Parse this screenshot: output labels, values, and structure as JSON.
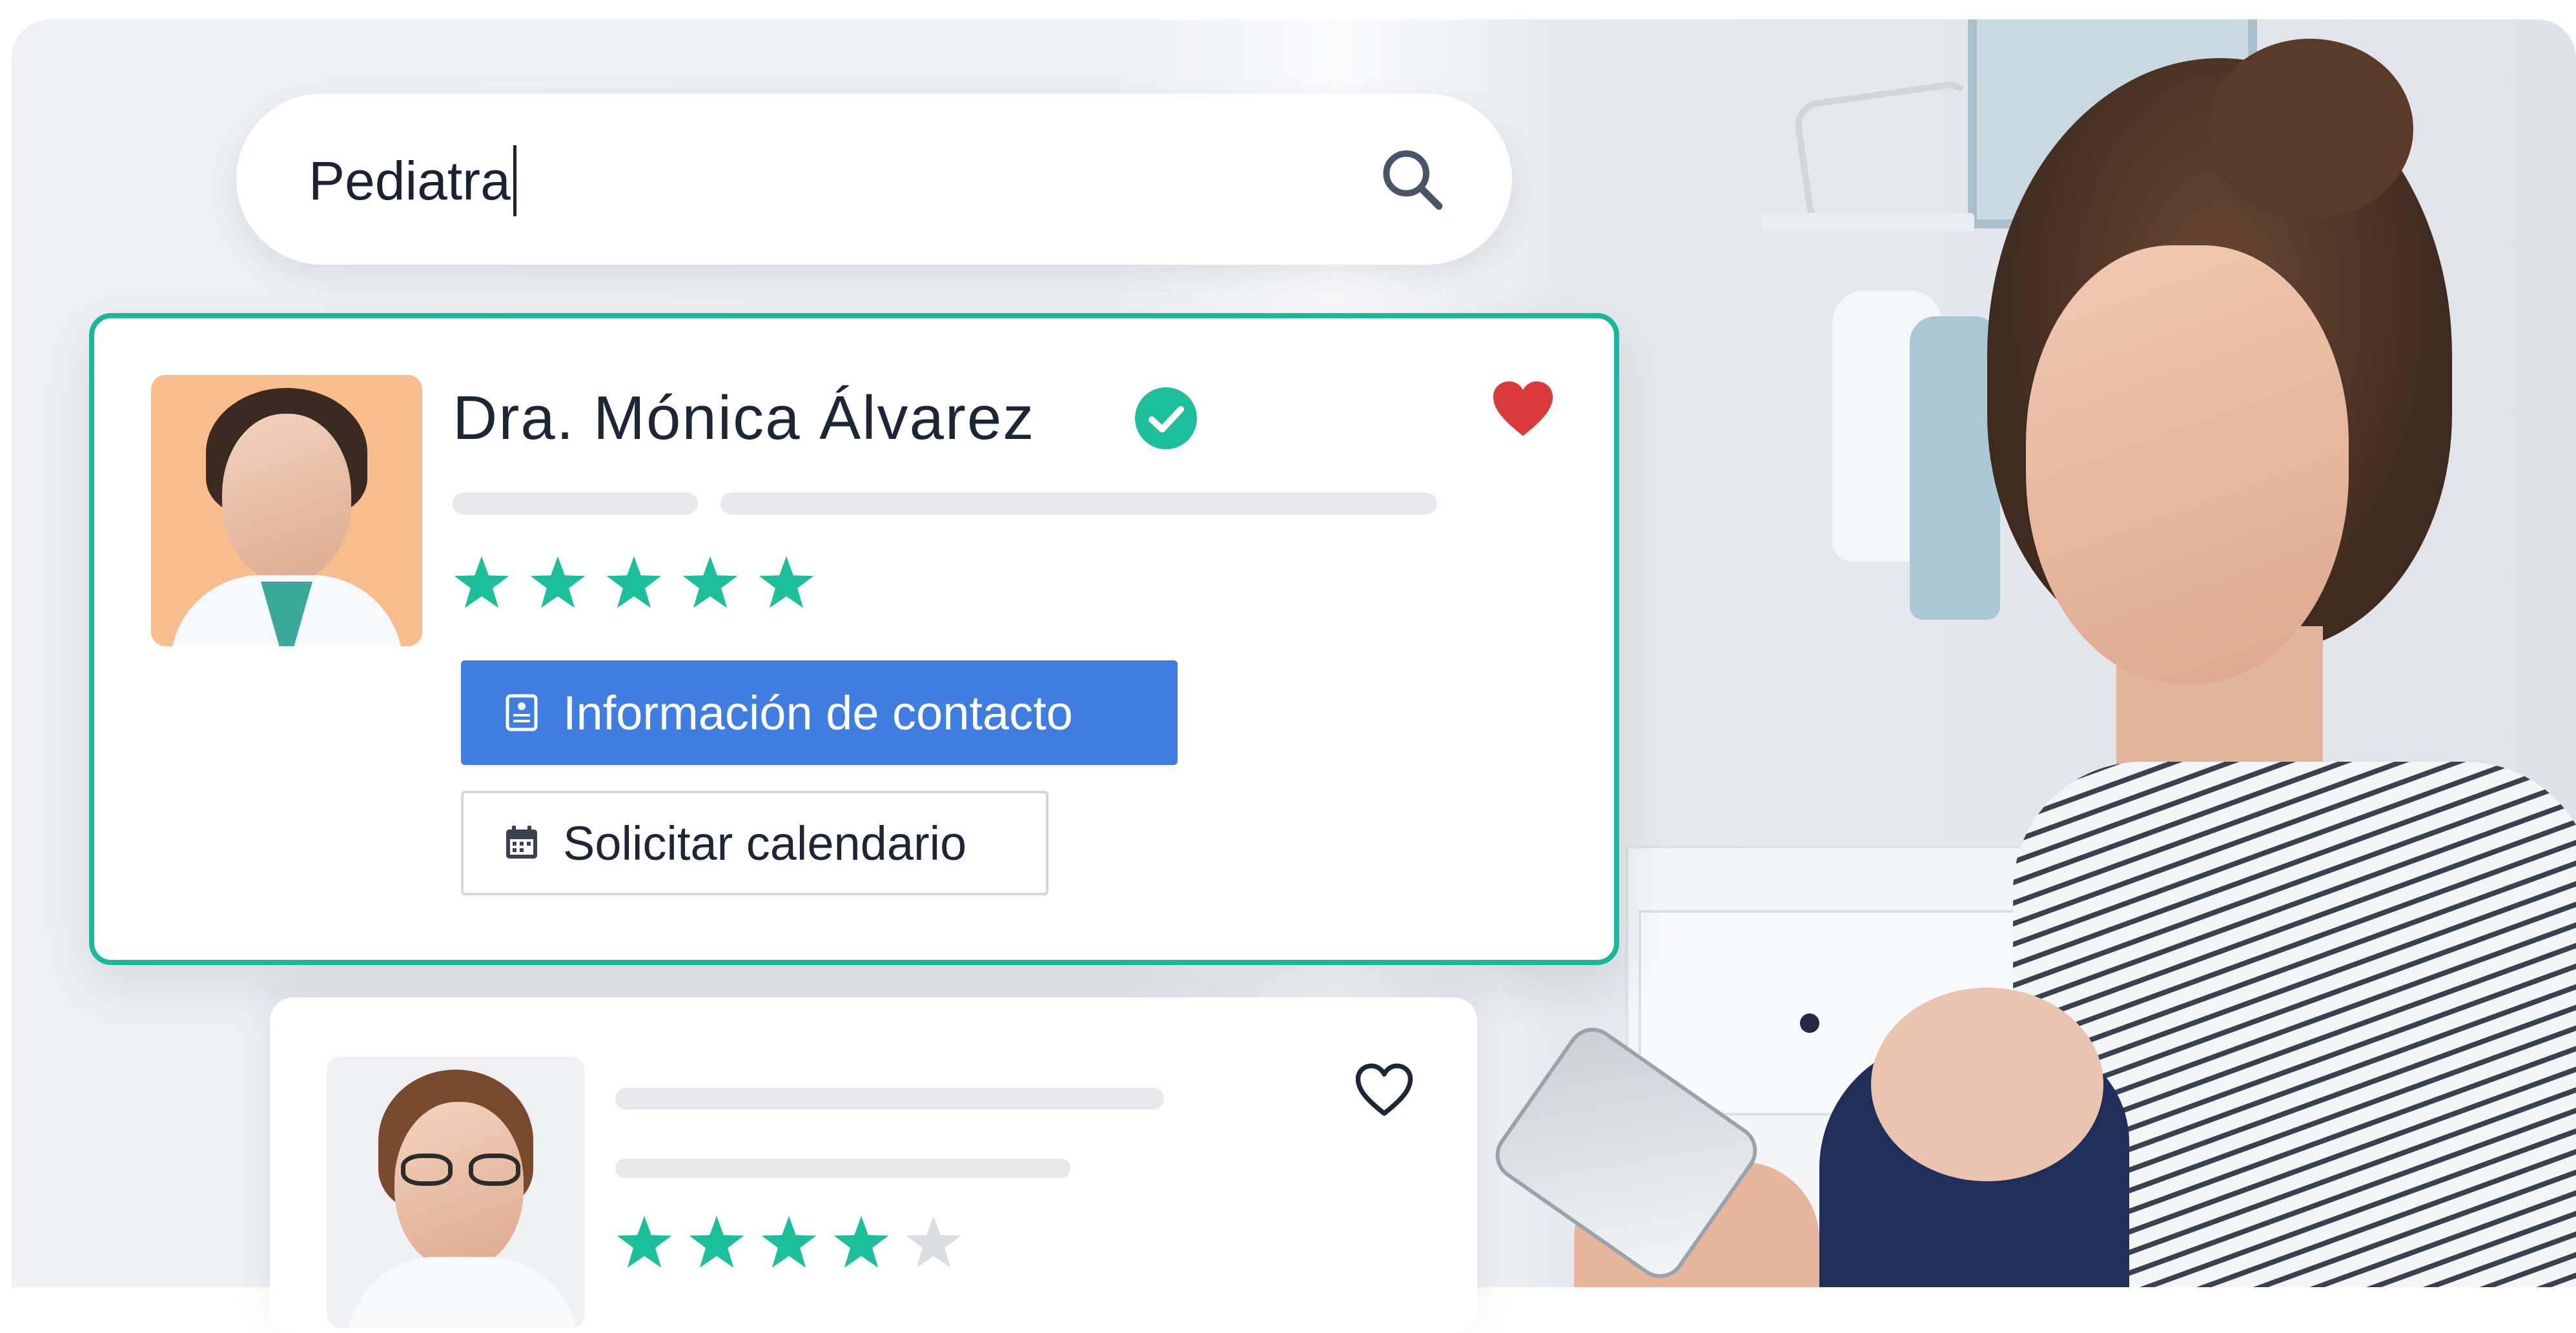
{
  "search": {
    "query": "Pediatra"
  },
  "results": [
    {
      "name": "Dra. Mónica Álvarez",
      "verified": true,
      "favorited": true,
      "rating": 5,
      "rating_max": 5,
      "buttons": {
        "contact_label": "Información de contacto",
        "calendar_label": "Solicitar calendario"
      }
    },
    {
      "favorited": false,
      "rating": 4,
      "rating_max": 5
    }
  ],
  "colors": {
    "accent_teal": "#18b89a",
    "star_filled": "#1dbf9b",
    "star_empty": "#dadde2",
    "primary_button": "#3f7ee0",
    "heart_red": "#d93b3b"
  },
  "icons": {
    "search": "magnifier-icon",
    "verified": "check-circle-icon",
    "favorite_on": "heart-filled-icon",
    "favorite_off": "heart-outline-icon",
    "contact": "contact-card-icon",
    "calendar": "calendar-icon",
    "rating": "star-icon"
  }
}
